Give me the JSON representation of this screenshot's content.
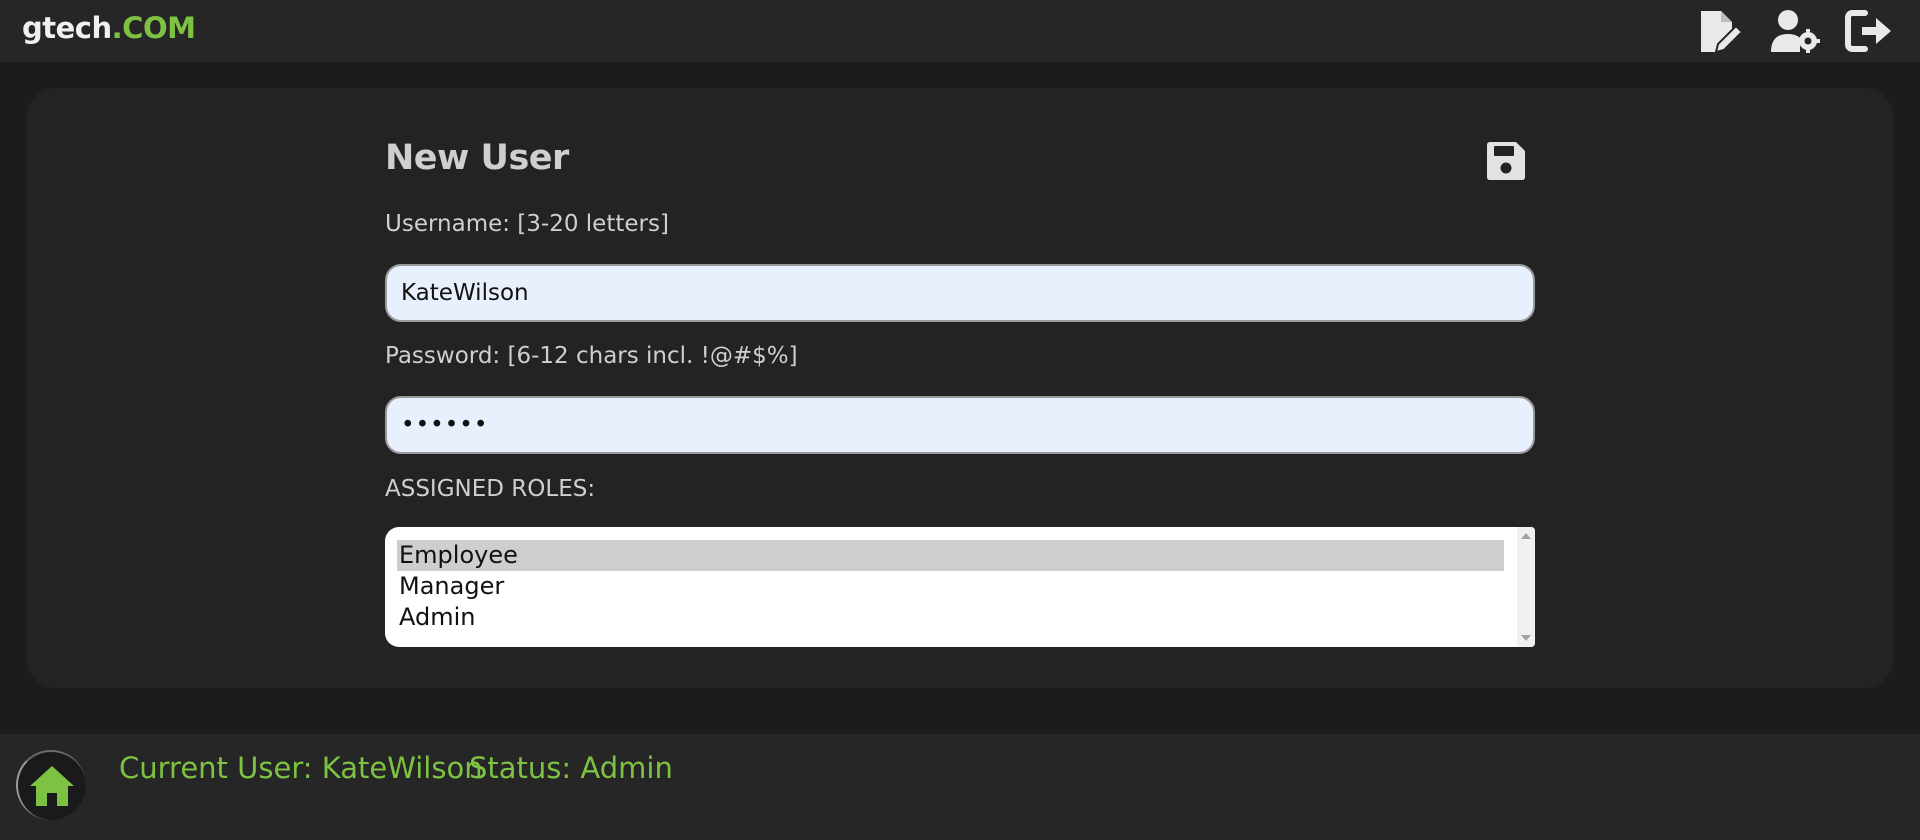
{
  "header": {
    "brand_main": "gtech",
    "brand_accent": ".COM",
    "icons": [
      "edit-document-icon",
      "user-settings-icon",
      "logout-icon"
    ]
  },
  "form": {
    "title": "New User",
    "save_icon": "floppy-disk-icon",
    "username_label": "Username: [3-20 letters]",
    "username_value": "KateWilson",
    "password_label": "Password: [6-12 chars incl. !@#$%]",
    "password_masked": "••••••",
    "roles_label": "ASSIGNED ROLES:",
    "roles": [
      {
        "label": "Employee",
        "selected": true
      },
      {
        "label": "Manager",
        "selected": false
      },
      {
        "label": "Admin",
        "selected": false
      }
    ]
  },
  "footer": {
    "home_icon": "home-icon",
    "current_user": "Current User: KateWilson",
    "status": "Status: Admin"
  },
  "colors": {
    "accent": "#7dc242",
    "background": "#1c1c1c",
    "panel": "#232323",
    "input_bg": "#e8effd"
  }
}
